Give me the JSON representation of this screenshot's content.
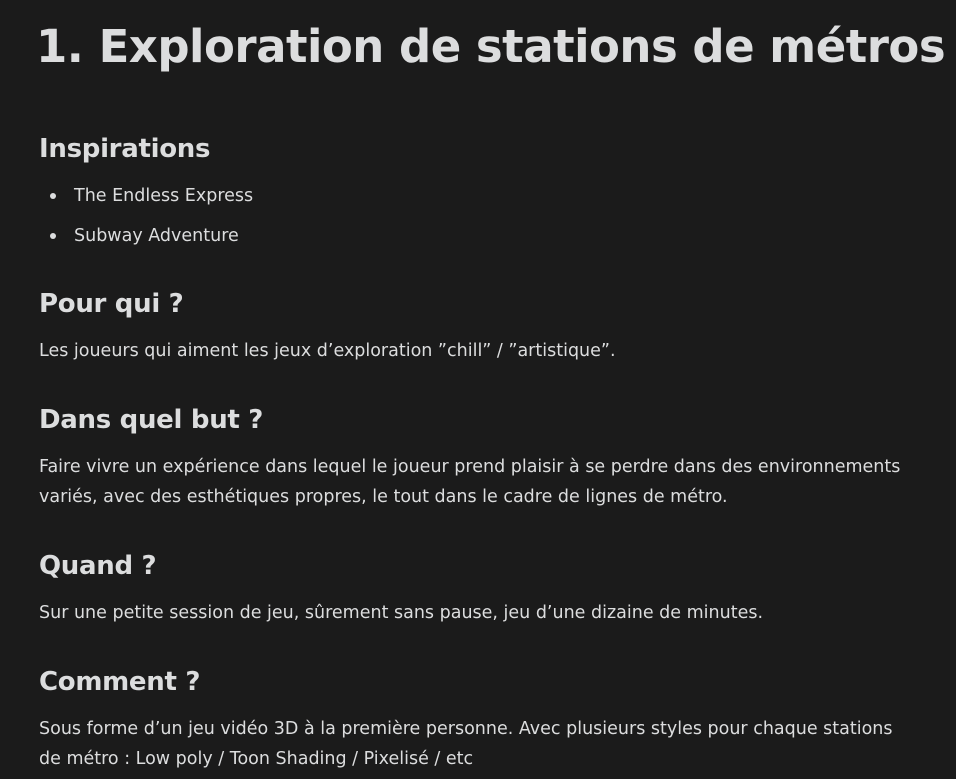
{
  "title": "1. Exploration de stations de métros",
  "sections": [
    {
      "heading": "Inspirations",
      "items": [
        "The Endless Express",
        "Subway Adventure"
      ]
    },
    {
      "heading": "Pour qui ?",
      "text": "Les joueurs qui aiment les jeux d’exploration ”chill” / ”artistique”."
    },
    {
      "heading": "Dans quel but ?",
      "text": "Faire vivre un expérience dans lequel le joueur prend plaisir à se perdre dans des environnements variés, avec des esthétiques propres, le tout dans le cadre de lignes de métro."
    },
    {
      "heading": "Quand ?",
      "text": "Sur une petite session de jeu, sûrement sans pause, jeu d’une dizaine de minutes."
    },
    {
      "heading": "Comment ?",
      "text": "Sous forme d’un jeu vidéo 3D à la première personne. Avec plusieurs styles pour chaque stations de métro : Low poly / Toon Shading / Pixelisé / etc"
    }
  ]
}
